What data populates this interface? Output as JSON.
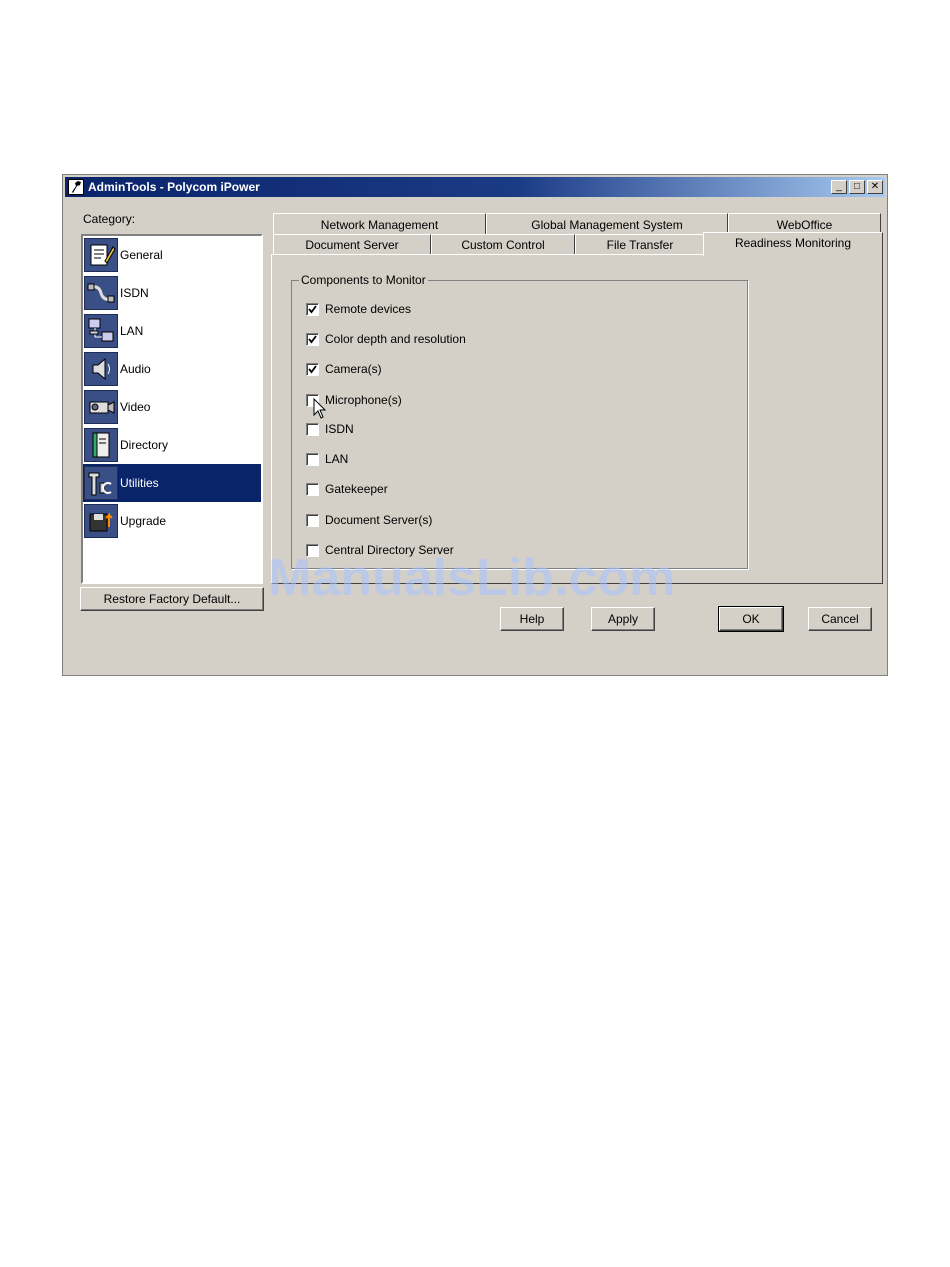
{
  "window": {
    "title": "AdminTools - Polycom iPower",
    "controls": {
      "minimize": "_",
      "maximize": "□",
      "close": "✕"
    }
  },
  "sidebar": {
    "label": "Category:",
    "items": [
      {
        "label": "General",
        "icon": "notepad-pencil-icon"
      },
      {
        "label": "ISDN",
        "icon": "isdn-cable-icon"
      },
      {
        "label": "LAN",
        "icon": "lan-computers-icon"
      },
      {
        "label": "Audio",
        "icon": "speaker-icon"
      },
      {
        "label": "Video",
        "icon": "video-camera-icon"
      },
      {
        "label": "Directory",
        "icon": "directory-book-icon"
      },
      {
        "label": "Utilities",
        "icon": "utilities-tools-icon",
        "selected": true
      },
      {
        "label": "Upgrade",
        "icon": "upgrade-disk-icon"
      }
    ],
    "restore_button": "Restore Factory Default..."
  },
  "tabs": {
    "row1": [
      "Network Management",
      "Global Management System",
      "WebOffice"
    ],
    "row2": [
      "Document Server",
      "Custom Control",
      "File Transfer",
      "Readiness Monitoring"
    ],
    "active": "Readiness Monitoring"
  },
  "group": {
    "title": "Components to Monitor",
    "items": [
      {
        "label": "Remote devices",
        "checked": true
      },
      {
        "label": "Color depth and resolution",
        "checked": true
      },
      {
        "label": "Camera(s)",
        "checked": true
      },
      {
        "label": "Microphone(s)",
        "checked": false
      },
      {
        "label": "ISDN",
        "checked": false
      },
      {
        "label": "LAN",
        "checked": false
      },
      {
        "label": "Gatekeeper",
        "checked": false
      },
      {
        "label": "Document Server(s)",
        "checked": false
      },
      {
        "label": "Central Directory Server",
        "checked": false
      }
    ]
  },
  "buttons": {
    "help": "Help",
    "apply": "Apply",
    "ok": "OK",
    "cancel": "Cancel"
  },
  "watermark": "ManualsLib.com",
  "colors": {
    "selection": "#0a246a",
    "face": "#d4d0c8",
    "watermark": "#a9c4ff"
  }
}
